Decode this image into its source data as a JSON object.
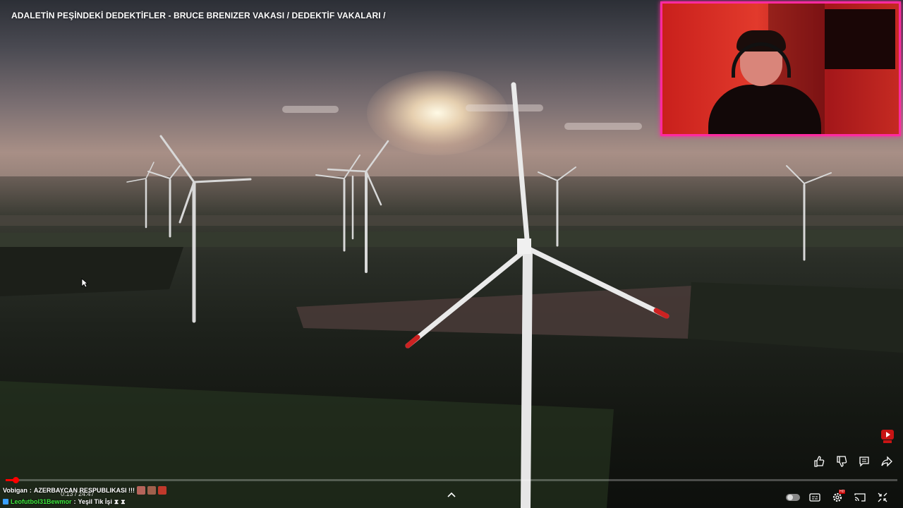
{
  "video": {
    "title": "ADALETİN PEŞİNDEKİ DEDEKTİFLER - BRUCE BRENIZER VAKASI / DEDEKTİF VAKALARI /",
    "current_time": "0:13",
    "duration": "24:47",
    "time_display": "0:13 / 24:47",
    "progress_fraction": 0.0088
  },
  "chat": {
    "messages": [
      {
        "user": "Vobigan",
        "text": "AZERBAYCAN RESPUBLIKASI !!!",
        "emotes": [
          "emote-face",
          "emote-face",
          "emote-face"
        ]
      },
      {
        "user": "Leofutbol31Bewmor",
        "text": "Yeşil Tik İşi",
        "emotes": [
          "hourglass-icon",
          "hourglass-icon"
        ]
      }
    ]
  },
  "actions": {
    "icons": [
      "like-icon",
      "dislike-icon",
      "comments-icon",
      "share-icon"
    ]
  },
  "controls": {
    "icons": [
      "autoplay-toggle",
      "subtitles-icon",
      "settings-icon",
      "cast-icon",
      "exit-fullscreen-icon"
    ],
    "settings_badge": "HD"
  },
  "colors": {
    "progress": "#ff0000",
    "webcam_border": "#ff2aa0",
    "chat_user_green": "#3de83d"
  }
}
